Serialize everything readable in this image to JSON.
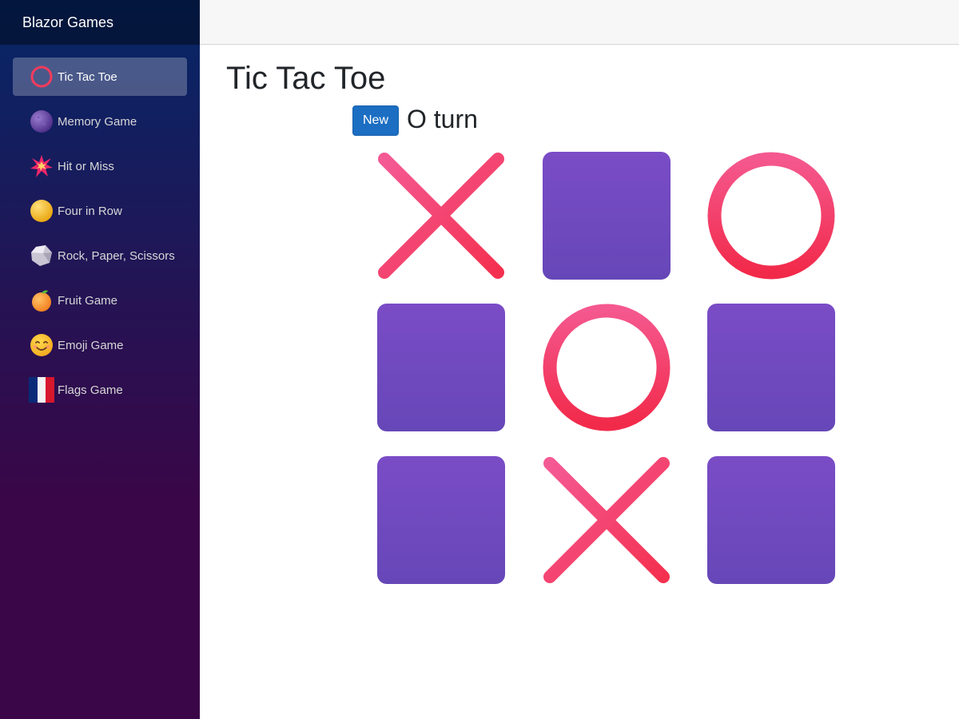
{
  "app": {
    "brand": "Blazor Games"
  },
  "sidebar": {
    "items": [
      {
        "label": "Tic Tac Toe",
        "icon": "ring-icon",
        "active": true
      },
      {
        "label": "Memory Game",
        "icon": "purple-ball-icon"
      },
      {
        "label": "Hit or Miss",
        "icon": "collision-icon"
      },
      {
        "label": "Four in Row",
        "icon": "yellow-ball-icon"
      },
      {
        "label": "Rock, Paper, Scissors",
        "icon": "rock-icon"
      },
      {
        "label": "Fruit Game",
        "icon": "tangerine-icon"
      },
      {
        "label": "Emoji Game",
        "icon": "smiling-face-icon"
      },
      {
        "label": "Flags Game",
        "icon": "france-flag-icon"
      }
    ]
  },
  "page": {
    "title": "Tic Tac Toe"
  },
  "game": {
    "new_label": "New",
    "turn_text": "O turn",
    "board": [
      "X",
      "",
      "O",
      "",
      "O",
      "",
      "",
      "X",
      ""
    ]
  },
  "colors": {
    "sidebar_top": "#052767",
    "sidebar_bottom": "#3a0647",
    "button": "#1b6ec2",
    "mark": "#f43b5c",
    "empty_cell": "#6e4ac0"
  }
}
